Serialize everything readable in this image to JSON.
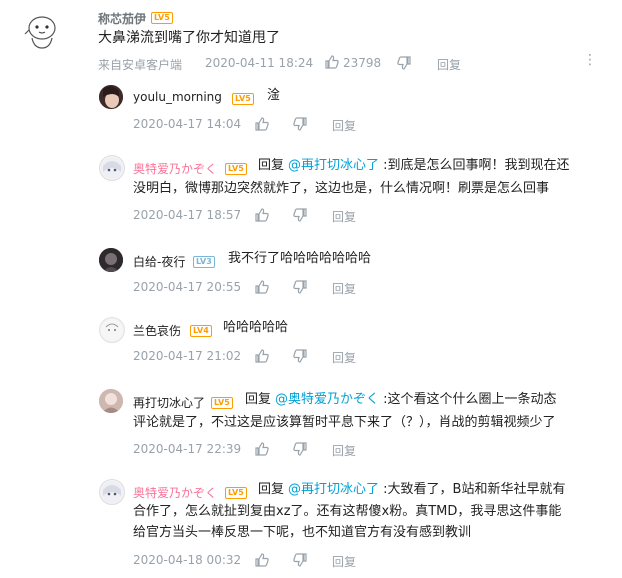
{
  "main": {
    "username": "称芯茄伊",
    "level": "LV5",
    "text": "大鼻涕流到嘴了你才知道甩了",
    "source": "来自安卓客户端",
    "time": "2020-04-11 18:24",
    "likes": "23798",
    "reply_label": "回复"
  },
  "replies": [
    {
      "username": "youlu_morning",
      "level": "LV5",
      "text": "淦",
      "time": "2020-04-17 14:04",
      "reply_label": "回复"
    },
    {
      "username": "奥特爱乃かぞく",
      "level": "LV5",
      "reply_word": "回复",
      "mention": "@再打切冰心了",
      "text_line1": ":到底是怎么回事啊！我到现在还",
      "text_line2": "没明白，微博那边突然就炸了，这边也是，什么情况啊！刷票是怎么回事",
      "time": "2020-04-17 18:57",
      "reply_label": "回复"
    },
    {
      "username": "白给-夜行",
      "level": "LV3",
      "text": "我不行了哈哈哈哈哈哈哈",
      "time": "2020-04-17 20:55",
      "reply_label": "回复"
    },
    {
      "username": "兰色哀伤",
      "level": "LV4",
      "text": "哈哈哈哈哈",
      "time": "2020-04-17 21:02",
      "reply_label": "回复"
    },
    {
      "username": "再打切冰心了",
      "level": "LV5",
      "reply_word": "回复",
      "mention": "@奥特爱乃かぞく",
      "text_line1": ":这个看这个什么圈上一条动态",
      "text_line2": "评论就是了，不过这是应该算暂时平息下来了（？），肖战的剪辑视频少了",
      "time": "2020-04-17 22:39",
      "reply_label": "回复"
    },
    {
      "username": "奥特爱乃かぞく",
      "level": "LV5",
      "reply_word": "回复",
      "mention": "@再打切冰心了",
      "text_line1": ":大致看了，B站和新华社早就有",
      "text_line2": "合作了，怎么就扯到复由xz了。还有这帮傻x粉。真TMD，我寻思这件事能",
      "text_line3": "给官方当头一棒反思一下呢，也不知道官方有没有感到教训",
      "time": "2020-04-18 00:32",
      "reply_label": "回复"
    }
  ],
  "colors": {
    "accent": "#00a1d6",
    "vip_name": "#fb7299",
    "level_orange": "#ff9c00",
    "level_blue": "#7bb5d8",
    "meta": "#99a2aa"
  },
  "icons": [
    "thumb-up-icon",
    "thumb-down-icon",
    "more-icon"
  ]
}
